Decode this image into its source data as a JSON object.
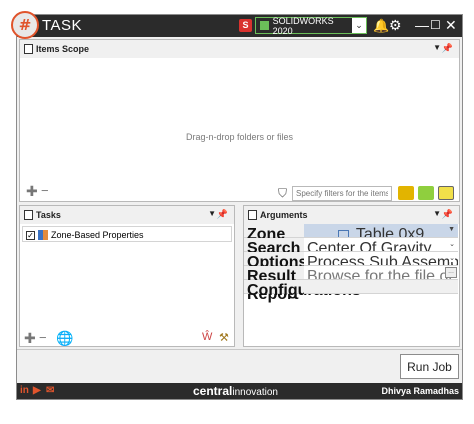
{
  "title_bar": {
    "app_title": "TASK",
    "version_select": "SOLIDWORKS 2020"
  },
  "items_scope": {
    "header": "Items Scope",
    "drop_text": "Drag-n-drop folders or files",
    "filter_placeholder": "Specify filters for the items"
  },
  "tasks": {
    "header": "Tasks",
    "items": [
      {
        "label": "Zone-Based Properties",
        "checked": true
      }
    ]
  },
  "arguments": {
    "header": "Arguments",
    "rows": [
      {
        "key": "Zone Rules",
        "value": "Table 0x9"
      },
      {
        "key": "Search By",
        "value": "Center Of Gravity"
      },
      {
        "key": "Options",
        "value": "Process Sub Assemblies, Process Part..."
      },
      {
        "key": "Result Report",
        "value": "Browse for the file or enter the file pat"
      },
      {
        "key": "Configurations",
        "value": ""
      }
    ],
    "browse_label": "..."
  },
  "run_button": "Run Job",
  "footer": {
    "brand_main": "central",
    "brand_sub": "innovation",
    "author": "Dhivya Ramadhas"
  },
  "colors": {
    "titlebar": "#2b2b2b",
    "accent": "#e0542c",
    "version_border": "#6bbf59",
    "selected_row": "#c9d6e8"
  }
}
